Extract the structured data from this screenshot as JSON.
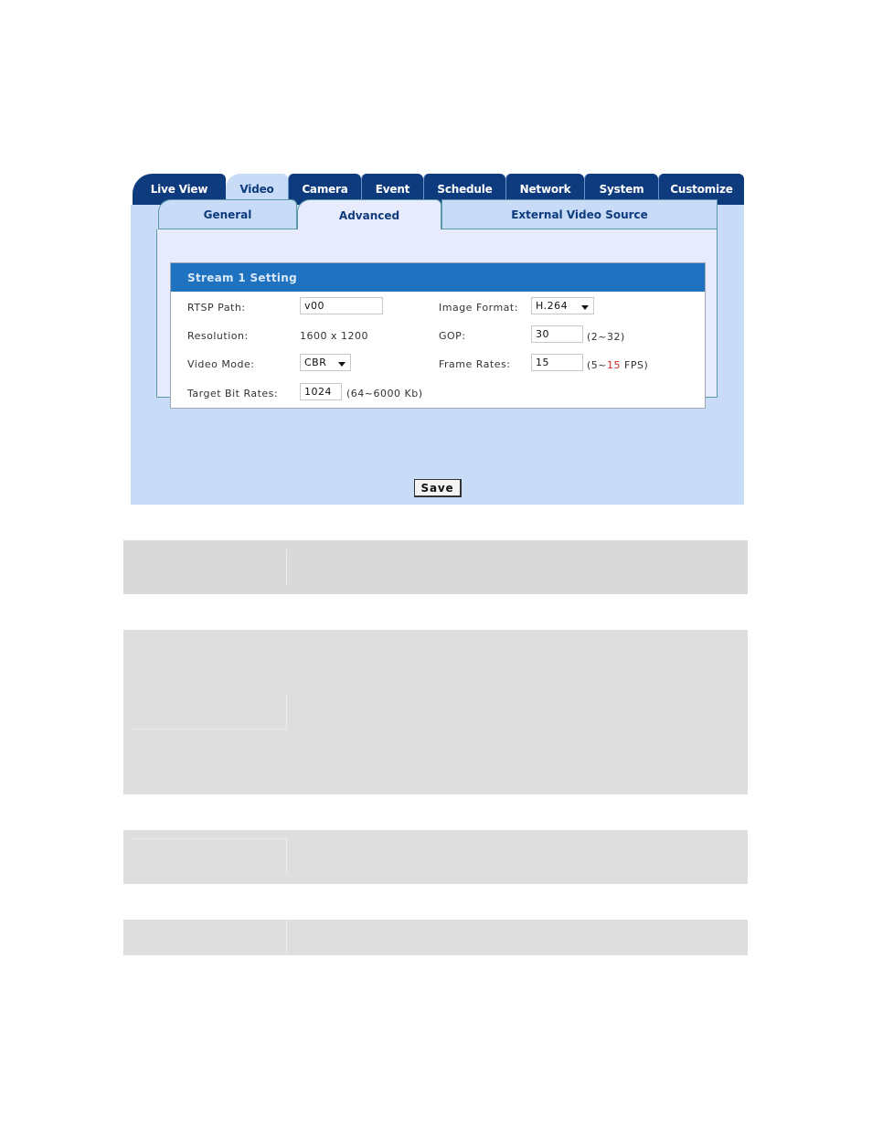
{
  "main_tabs": [
    {
      "label": "Live View",
      "active": false
    },
    {
      "label": "Video",
      "active": true
    },
    {
      "label": "Camera",
      "active": false
    },
    {
      "label": "Event",
      "active": false
    },
    {
      "label": "Schedule",
      "active": false
    },
    {
      "label": "Network",
      "active": false
    },
    {
      "label": "System",
      "active": false
    },
    {
      "label": "Customize",
      "active": false
    }
  ],
  "sub_tabs": [
    {
      "label": "General",
      "active": false
    },
    {
      "label": "Advanced",
      "active": true
    },
    {
      "label": "External Video Source",
      "active": false
    }
  ],
  "stream": {
    "title": "Stream 1 Setting",
    "rtsp_path": {
      "label": "RTSP Path:",
      "value": "v00"
    },
    "resolution": {
      "label": "Resolution:",
      "value": "1600 x 1200"
    },
    "video_mode": {
      "label": "Video Mode:",
      "value": "CBR"
    },
    "target_bit_rates": {
      "label": "Target Bit Rates:",
      "value": "1024",
      "hint": "(64~6000 Kb)"
    },
    "image_format": {
      "label": "Image Format:",
      "value": "H.264"
    },
    "gop": {
      "label": "GOP:",
      "value": "30",
      "hint": "(2~32)"
    },
    "frame_rates": {
      "label": "Frame Rates:",
      "value": "15",
      "hint_prefix": "(5~",
      "hint_max": "15",
      "hint_suffix": " FPS)",
      "hint_max_color": "#e02020"
    }
  },
  "save_label": "Save",
  "colors": {
    "tab_bg": "#0e3a7e",
    "panel_bg": "#c8dcf8",
    "stream_header": "#1e72c0",
    "placeholder_grey": "#dedede"
  }
}
